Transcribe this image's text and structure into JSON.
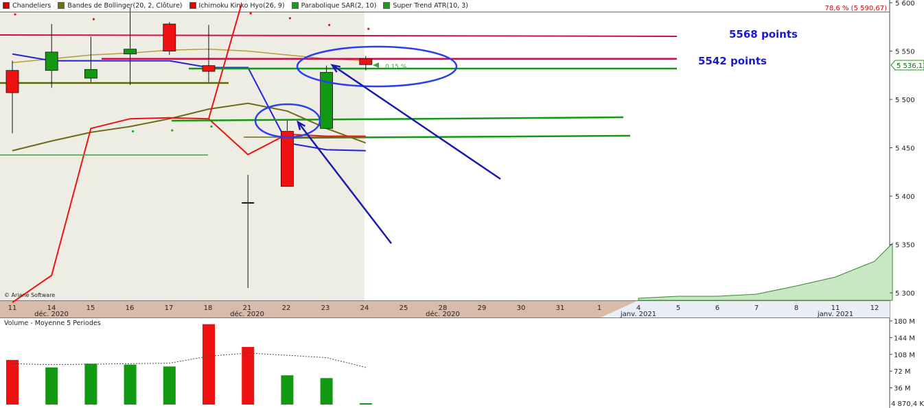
{
  "legend": [
    {
      "label": "Chandeliers",
      "color": "#cc0000"
    },
    {
      "label": "Bandes de Bollinger(20, 2, Clôture)",
      "color": "#6b6b1a"
    },
    {
      "label": "Ichimoku Kinko Hyo(26, 9)",
      "color": "#dd0000"
    },
    {
      "label": "Parabolique SAR(2, 10)",
      "color": "#1a9a1a"
    },
    {
      "label": "Super Trend ATR(10, 3)",
      "color": "#1a9a1a"
    }
  ],
  "fib_label": "78,6 % (5 590,67)",
  "price_badge": "5 536,13",
  "pct_label": "0,15 %",
  "copyright": "© Ariane Software",
  "annotations": [
    "5568 points",
    "5542 points"
  ],
  "volume_title": "Volume  - Moyenne 5 Periodes",
  "x_ticks": [
    "11",
    "14",
    "15",
    "16",
    "17",
    "18",
    "21",
    "22",
    "23",
    "24",
    "25",
    "28",
    "29",
    "30",
    "31",
    "1",
    "4",
    "5",
    "6",
    "7",
    "8",
    "11",
    "12"
  ],
  "month_labels": [
    {
      "text": "déc. 2020",
      "after": "14"
    },
    {
      "text": "déc. 2020",
      "after": "21"
    },
    {
      "text": "déc. 2020",
      "after": "28"
    },
    {
      "text": "janv. 2021",
      "after": "4"
    },
    {
      "text": "janv. 2021",
      "after": "11"
    }
  ],
  "y_ticks_price": [
    "5 600",
    "5 550",
    "5 500",
    "5 450",
    "5 400",
    "5 350",
    "5 300"
  ],
  "y_ticks_volume": [
    "180 M",
    "144 M",
    "108 M",
    "72 M",
    "36 M"
  ],
  "volume_bottom_label": "4 870,4 K",
  "colors": {
    "up": "#119911",
    "down": "#ee1111",
    "annotation": "#1a1acc",
    "resistance": "#cc1144",
    "support": "#119911"
  },
  "chart_data": {
    "type": "candlestick",
    "dates": [
      "11",
      "14",
      "15",
      "16",
      "17",
      "18",
      "21",
      "22",
      "23",
      "24"
    ],
    "ylim": [
      5290,
      5605
    ],
    "candles": [
      {
        "date": "11",
        "open": 5530,
        "high": 5540,
        "low": 5465,
        "close": 5507
      },
      {
        "date": "14",
        "open": 5530,
        "high": 5578,
        "low": 5512,
        "close": 5549
      },
      {
        "date": "15",
        "open": 5522,
        "high": 5565,
        "low": 5518,
        "close": 5531
      },
      {
        "date": "16",
        "open": 5547,
        "high": 5595,
        "low": 5515,
        "close": 5552
      },
      {
        "date": "17",
        "open": 5578,
        "high": 5580,
        "low": 5546,
        "close": 5550
      },
      {
        "date": "18",
        "open": 5535,
        "high": 5577,
        "low": 5518,
        "close": 5529
      },
      {
        "date": "21",
        "open": 5393,
        "high": 5422,
        "low": 5305,
        "close": 5393
      },
      {
        "date": "22",
        "open": 5467,
        "high": 5478,
        "low": 5410,
        "close": 5410
      },
      {
        "date": "23",
        "open": 5470,
        "high": 5535,
        "low": 5470,
        "close": 5528
      },
      {
        "date": "24",
        "open": 5542,
        "high": 5545,
        "low": 5530,
        "close": 5536
      }
    ],
    "volume": {
      "ylim": [
        0,
        190
      ],
      "values": [
        96,
        80,
        88,
        86,
        82,
        173,
        124,
        63,
        57,
        3
      ],
      "directions": [
        "down",
        "up",
        "up",
        "up",
        "up",
        "down",
        "down",
        "up",
        "up",
        "up"
      ],
      "moving_average": [
        88,
        86,
        87,
        88,
        89,
        104,
        111,
        106,
        101,
        80
      ]
    },
    "bollinger_mid": [
      5538,
      5542,
      5546,
      5548,
      5551,
      5552,
      5550,
      5546,
      5542,
      5540
    ],
    "bollinger_lower": [
      5447,
      5457,
      5466,
      5472,
      5480,
      5490,
      5496,
      5488,
      5470,
      5455
    ],
    "ichimoku_tenkan": [
      5547,
      5540,
      5540,
      5540,
      5540,
      5533,
      5533,
      5455,
      5448,
      5447
    ],
    "ichimoku_kijun": [
      5290,
      5318,
      5470,
      5480,
      5481,
      5480,
      5443,
      5464,
      5462,
      5462
    ],
    "sar_dots": [
      5588,
      null,
      5583,
      5467,
      5468,
      5472,
      5589,
      5584,
      5577,
      5573
    ],
    "horizontal_lines": [
      {
        "value": 5568,
        "label": "5568 points"
      },
      {
        "value": 5542,
        "label": "5542 points"
      }
    ]
  }
}
